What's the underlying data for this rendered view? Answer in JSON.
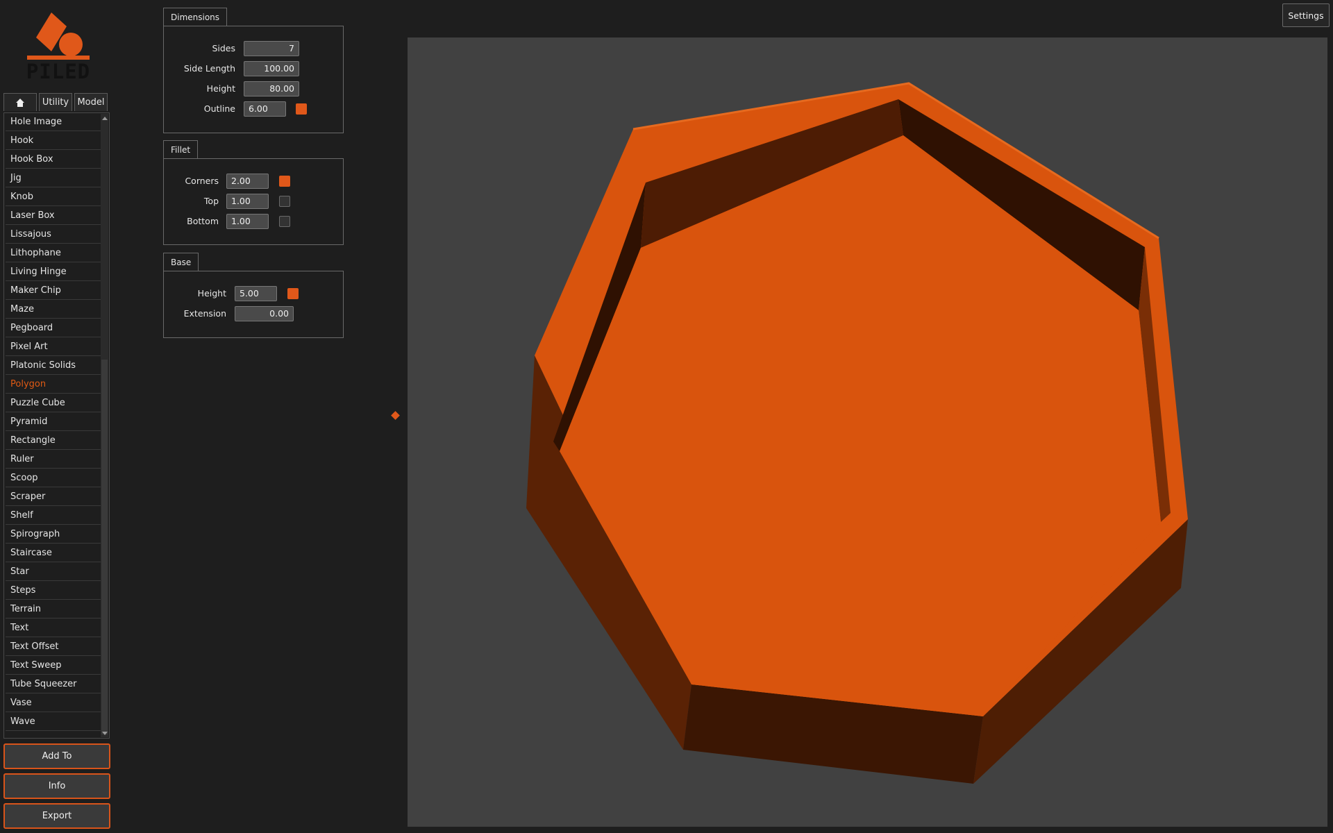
{
  "app": {
    "logo_text": "PILED",
    "accent_color": "#e0581a"
  },
  "tabs": {
    "home_icon": "home-icon",
    "utility": "Utility",
    "model": "Model"
  },
  "model_list": {
    "items": [
      "Hole Image",
      "Hook",
      "Hook Box",
      "Jig",
      "Knob",
      "Laser Box",
      "Lissajous",
      "Lithophane",
      "Living Hinge",
      "Maker Chip",
      "Maze",
      "Pegboard",
      "Pixel Art",
      "Platonic Solids",
      "Polygon",
      "Puzzle Cube",
      "Pyramid",
      "Rectangle",
      "Ruler",
      "Scoop",
      "Scraper",
      "Shelf",
      "Spirograph",
      "Staircase",
      "Star",
      "Steps",
      "Terrain",
      "Text",
      "Text Offset",
      "Text Sweep",
      "Tube Squeezer",
      "Vase",
      "Wave"
    ],
    "selected": "Polygon"
  },
  "actions": {
    "add_to": "Add To",
    "info": "Info",
    "export": "Export"
  },
  "settings_label": "Settings",
  "dimensions": {
    "title": "Dimensions",
    "sides_label": "Sides",
    "sides_value": "7",
    "side_length_label": "Side Length",
    "side_length_value": "100.00",
    "height_label": "Height",
    "height_value": "80.00",
    "outline_label": "Outline",
    "outline_value": "6.00",
    "outline_enabled": true
  },
  "fillet": {
    "title": "Fillet",
    "corners_label": "Corners",
    "corners_value": "2.00",
    "corners_enabled": true,
    "top_label": "Top",
    "top_value": "1.00",
    "top_enabled": false,
    "bottom_label": "Bottom",
    "bottom_value": "1.00",
    "bottom_enabled": false
  },
  "base": {
    "title": "Base",
    "height_label": "Height",
    "height_value": "5.00",
    "height_enabled": true,
    "extension_label": "Extension",
    "extension_value": "0.00"
  },
  "viewport": {
    "background": "#414141",
    "model_color": "#d9540d"
  }
}
